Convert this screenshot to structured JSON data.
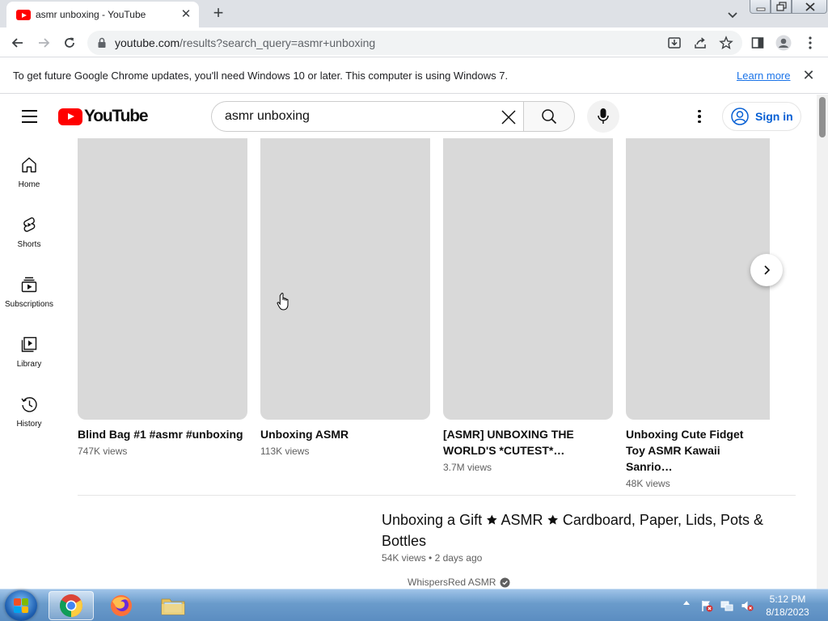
{
  "browser": {
    "tab_title": "asmr unboxing - YouTube",
    "url_host": "youtube.com",
    "url_rest": "/results?search_query=asmr+unboxing"
  },
  "infobar": {
    "message": "To get future Google Chrome updates, you'll need Windows 10 or later. This computer is using Windows 7.",
    "learn_more": "Learn more"
  },
  "youtube": {
    "logo_text": "YouTube",
    "search_query": "asmr unboxing",
    "sign_in": "Sign in",
    "guide": [
      {
        "label": "Home",
        "icon": "home-icon"
      },
      {
        "label": "Shorts",
        "icon": "shorts-icon"
      },
      {
        "label": "Subscriptions",
        "icon": "subscriptions-icon"
      },
      {
        "label": "Library",
        "icon": "library-icon"
      },
      {
        "label": "History",
        "icon": "history-icon"
      }
    ],
    "shorts": [
      {
        "title": "Blind Bag #1 #asmr #unboxing",
        "views": "747K views"
      },
      {
        "title": "Unboxing ASMR",
        "views": "113K views"
      },
      {
        "title": "[ASMR] UNBOXING THE WORLD'S *CUTEST*…",
        "views": "3.7M views"
      },
      {
        "title": "Unboxing Cute Fidget Toy ASMR Kawaii Sanrio…",
        "views": "48K views"
      }
    ],
    "video": {
      "title": "Unboxing a Gift 🟊 ASMR 🟊 Cardboard, Paper, Lids, Pots & Bottles",
      "views": "54K views",
      "age": "2 days ago",
      "channel": "WhispersRed ASMR"
    }
  },
  "taskbar": {
    "time": "5:12 PM",
    "date": "8/18/2023"
  },
  "colors": {
    "youtube_red": "#ff0000",
    "link_blue": "#065fd4",
    "thumb_gray": "#d9d9d9"
  }
}
